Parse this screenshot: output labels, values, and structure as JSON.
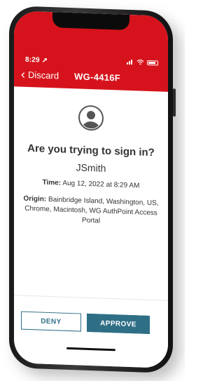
{
  "status_bar": {
    "time": "8:29",
    "location_arrow": "➚",
    "signal_icon": "signal-bars-icon",
    "wifi_icon": "wifi-icon",
    "battery_icon": "battery-icon"
  },
  "nav": {
    "back_icon": "chevron-left-icon",
    "back_label": "Discard",
    "title": "WG-4416F"
  },
  "auth_request": {
    "avatar_icon": "user-circle-icon",
    "prompt": "Are you trying to sign in?",
    "username": "JSmith",
    "time_label": "Time:",
    "time_value": "Aug 12, 2022 at 8:29 AM",
    "origin_label": "Origin:",
    "origin_value": "Bainbridge Island, Washington, US, Chrome, Macintosh, WG AuthPoint Access Portal"
  },
  "actions": {
    "deny_label": "DENY",
    "approve_label": "APPROVE"
  },
  "colors": {
    "header": "#d6131c",
    "accent": "#2f6f86"
  }
}
